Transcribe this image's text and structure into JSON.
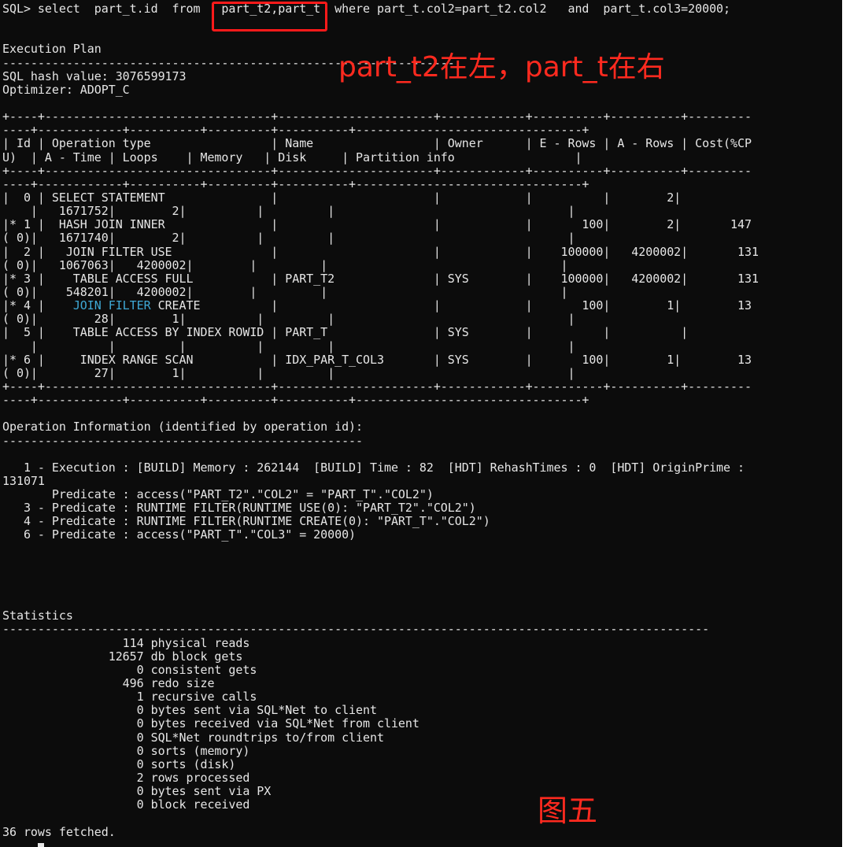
{
  "terminal": {
    "lines": [
      "SQL> select  part_t.id  from   part_t2,part_t  where part_t.col2=part_t2.col2   and  part_t.col3=20000;",
      "",
      "",
      "Execution Plan",
      "----------------------------------------------------------------",
      "SQL hash value: 3076599173",
      "Optimizer: ADOPT_C",
      "",
      "+----+--------------------------------+----------------------+------------+----------+----------+---------",
      "----+------------+----------+---------+----------+--------------------------------+",
      "| Id | Operation type                 | Name                 | Owner      | E - Rows | A - Rows | Cost(%CP",
      "U)  | A - Time | Loops    | Memory   | Disk     | Partition info                 |",
      "+----+--------------------------------+----------------------+------------+----------+----------+---------",
      "----+------------+----------+---------+----------+--------------------------------+",
      "|  0 | SELECT STATEMENT               |                      |            |          |        2|",
      "    |   1671752|        2|          |         |                                 |",
      "|* 1 |  HASH JOIN INNER               |                      |            |       100|        2|       147",
      "( 0)|   1671740|        2|          |         |                                 |",
      "|  2 |   JOIN FILTER USE              |                      |            |    100000|   4200002|       131",
      "( 0)|   1067063|   4200002|        |         |                                 |",
      "|* 3 |    TABLE ACCESS FULL           | PART_T2              | SYS        |    100000|   4200002|       131",
      "( 0)|    548201|   4200002|        |         |                                 |",
      "|* 4 |    JOIN FILTER CREATE          |                      |            |       100|        1|        13",
      "( 0)|        28|        1|          |         |                                 |",
      "|  5 |    TABLE ACCESS BY INDEX ROWID | PART_T               | SYS        |          |          |",
      "    |          |         |          |         |                                 |",
      "|* 6 |     INDEX RANGE SCAN           | IDX_PAR_T_COL3       | SYS        |       100|        1|        13",
      "( 0)|        27|        1|          |         |                                 |",
      "+----+--------------------------------+----------------------+------------+----------+----------+---------",
      "----+------------+----------+---------+----------+--------------------------------+",
      "",
      "Operation Information (identified by operation id):",
      "---------------------------------------------------",
      "",
      "   1 - Execution : [BUILD] Memory : 262144  [BUILD] Time : 82  [HDT] RehashTimes : 0  [HDT] OriginPrime :",
      "131071",
      "       Predicate : access(\"PART_T2\".\"COL2\" = \"PART_T\".\"COL2\")",
      "   3 - Predicate : RUNTIME FILTER(RUNTIME USE(0): \"PART_T2\".\"COL2\")",
      "   4 - Predicate : RUNTIME FILTER(RUNTIME CREATE(0): \"PART_T\".\"COL2\")",
      "   6 - Predicate : access(\"PART_T\".\"COL3\" = 20000)",
      "",
      "",
      "",
      "",
      "",
      "Statistics",
      "----------------------------------------------------------------------------------------------------",
      "                 114 physical reads",
      "               12657 db block gets",
      "                   0 consistent gets",
      "                 496 redo size",
      "                   1 recursive calls",
      "                   0 bytes sent via SQL*Net to client",
      "                   0 bytes received via SQL*Net from client",
      "                   0 SQL*Net roundtrips to/from client",
      "                   0 sorts (memory)",
      "                   0 sorts (disk)",
      "                   2 rows processed",
      "                   0 bytes sent via PX",
      "                   0 block received",
      "",
      "36 rows fetched."
    ],
    "highlight_line": 22,
    "highlight_text": "JOIN FILTER",
    "colors": {
      "background": "#0c0c0c",
      "text": "#e6e6e6",
      "highlight": "#3fa9d6",
      "annotation": "#ff2a1f"
    }
  },
  "annotations": {
    "join_order": "part_t2在左，part_t在右",
    "figure_label": "图五"
  }
}
